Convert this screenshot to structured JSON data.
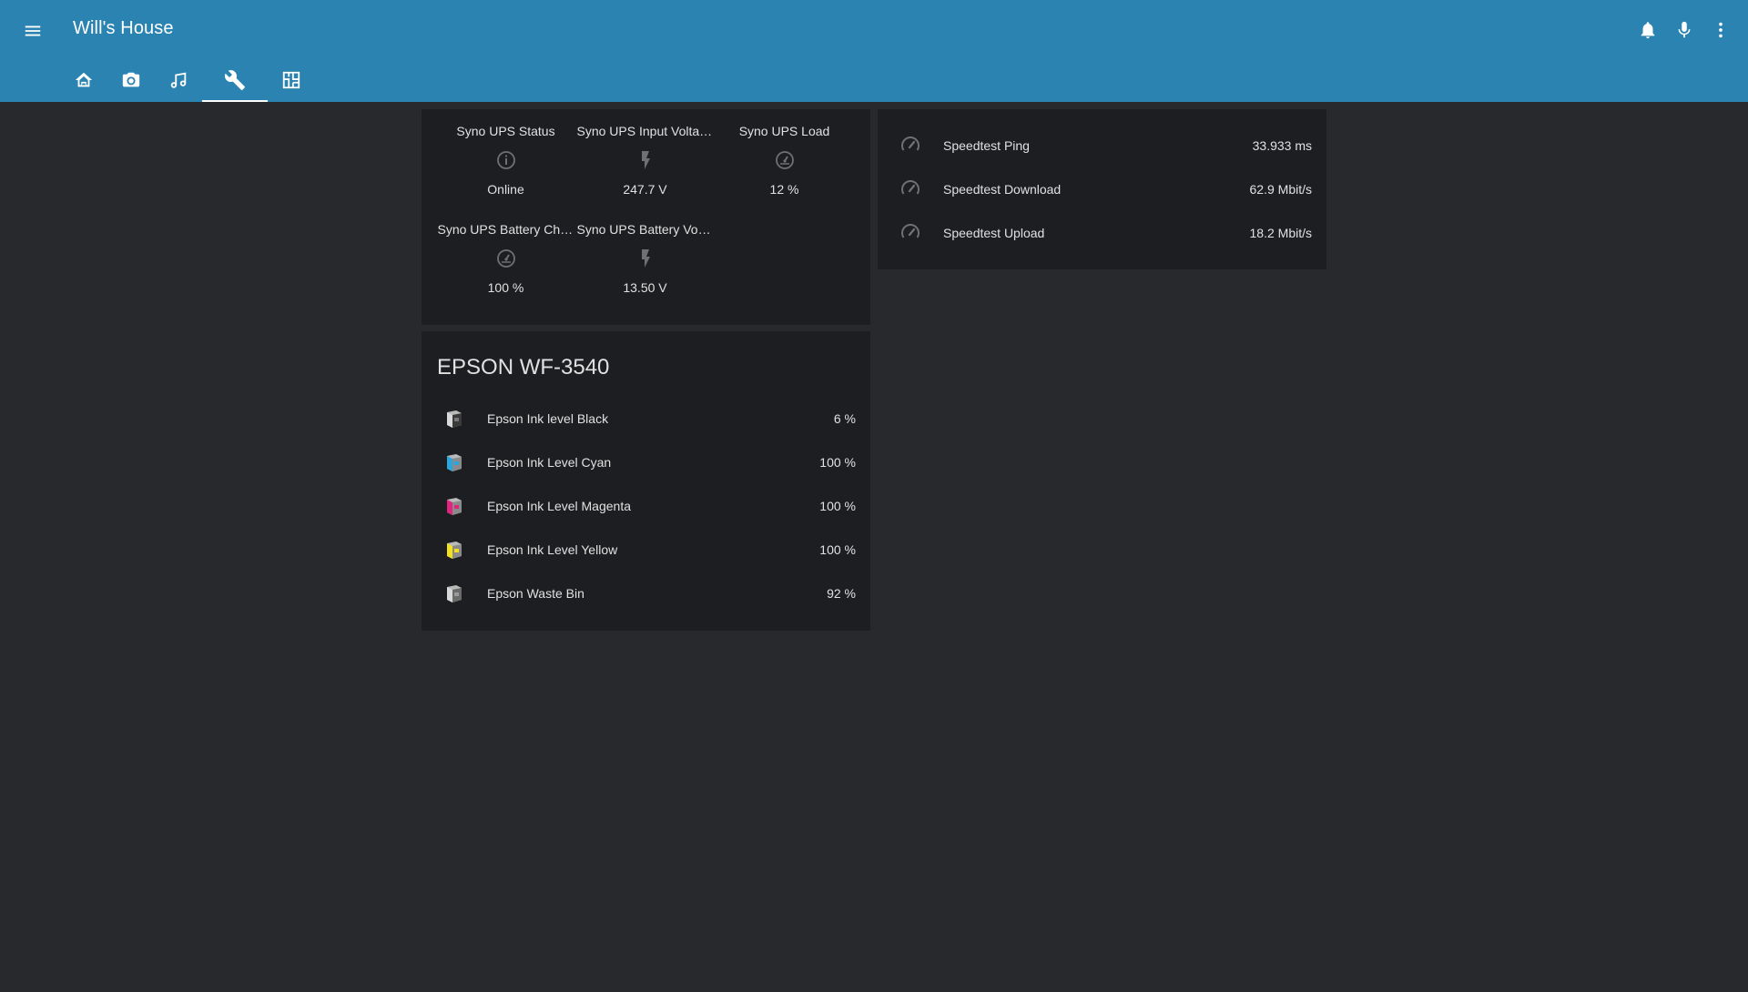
{
  "header": {
    "title": "Will's House",
    "actions": [
      "bell-icon",
      "microphone-icon",
      "dots-vertical-icon"
    ]
  },
  "tabs": [
    {
      "icon": "home-automation-icon",
      "active": false
    },
    {
      "icon": "camera-icon",
      "active": false
    },
    {
      "icon": "music-note-icon",
      "active": false
    },
    {
      "icon": "wrench-icon",
      "active": true
    },
    {
      "icon": "floor-plan-icon",
      "active": false
    }
  ],
  "ups": {
    "items": [
      {
        "name": "Syno UPS Status",
        "icon": "information-outline-icon",
        "state": "Online"
      },
      {
        "name": "Syno UPS Input Voltage",
        "icon": "flash-icon",
        "state": "247.7 V"
      },
      {
        "name": "Syno UPS Load",
        "icon": "gauge-icon",
        "state": "12 %"
      },
      {
        "name": "Syno UPS Battery Charge",
        "icon": "gauge-icon",
        "state": "100 %"
      },
      {
        "name": "Syno UPS Battery Voltage",
        "icon": "flash-icon",
        "state": "13.50 V"
      }
    ]
  },
  "speedtest": {
    "rows": [
      {
        "name": "Speedtest Ping",
        "icon": "speedometer-icon",
        "value": "33.933 ms"
      },
      {
        "name": "Speedtest Download",
        "icon": "speedometer-icon",
        "value": "62.9 Mbit/s"
      },
      {
        "name": "Speedtest Upload",
        "icon": "speedometer-icon",
        "value": "18.2 Mbit/s"
      }
    ]
  },
  "epson": {
    "title": "EPSON WF-3540",
    "rows": [
      {
        "name": "Epson Ink level Black",
        "icon": "ink-cartridge-black-icon",
        "color": "#3a3a3a",
        "value": "6 %"
      },
      {
        "name": "Epson Ink Level Cyan",
        "icon": "ink-cartridge-cyan-icon",
        "color": "#27a6e0",
        "value": "100 %"
      },
      {
        "name": "Epson Ink Level Magenta",
        "icon": "ink-cartridge-magenta-icon",
        "color": "#e0257e",
        "value": "100 %"
      },
      {
        "name": "Epson Ink Level Yellow",
        "icon": "ink-cartridge-yellow-icon",
        "color": "#f2e21e",
        "value": "100 %"
      },
      {
        "name": "Epson Waste Bin",
        "icon": "ink-cartridge-waste-icon",
        "color": "#9a9a9a",
        "value": "92 %"
      }
    ]
  },
  "colors": {
    "header": "#2a83b1",
    "background": "#28292d",
    "card": "#1d1e21",
    "icon": "#6f7073"
  }
}
